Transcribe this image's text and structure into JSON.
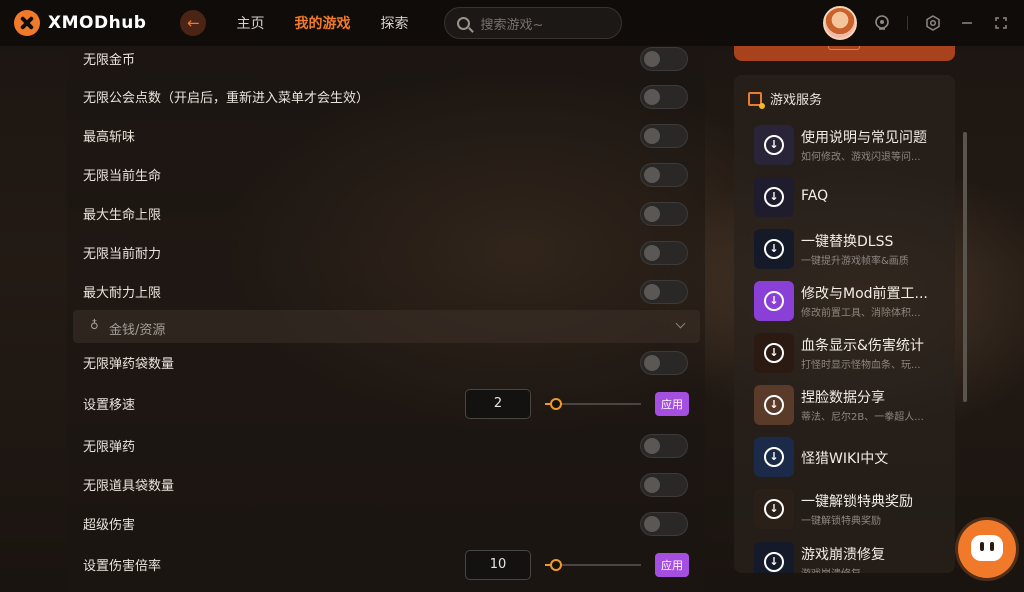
{
  "app": {
    "name": "XMODhub",
    "brand_color": "#f07a2a"
  },
  "nav": {
    "items": [
      {
        "label": "主页",
        "active": false
      },
      {
        "label": "我的游戏",
        "active": true
      },
      {
        "label": "探索",
        "active": false
      }
    ],
    "search_placeholder": "搜索游戏~"
  },
  "toolbar": {
    "icons": [
      "avatar",
      "notification-icon",
      "settings-icon",
      "minimize-icon",
      "maximize-icon"
    ]
  },
  "settings": {
    "rows_top": [
      {
        "label": "无限金币",
        "enabled": false
      },
      {
        "label": "无限公会点数（开启后，重新进入菜单才会生效）",
        "enabled": false
      },
      {
        "label": "最高斩味",
        "enabled": false
      },
      {
        "label": "无限当前生命",
        "enabled": false
      },
      {
        "label": "最大生命上限",
        "enabled": false
      },
      {
        "label": "无限当前耐力",
        "enabled": false
      },
      {
        "label": "最大耐力上限",
        "enabled": false
      }
    ],
    "section": {
      "label": "金钱/资源",
      "icon": "money-bag-icon"
    },
    "rows_bottom": [
      {
        "label": "无限弹药袋数量",
        "type": "toggle",
        "enabled": false
      },
      {
        "label": "设置移速",
        "type": "slider",
        "value": "2",
        "apply": "应用",
        "level": 0.05
      },
      {
        "label": "无限弹药",
        "type": "toggle",
        "enabled": false
      },
      {
        "label": "无限道具袋数量",
        "type": "toggle",
        "enabled": false
      },
      {
        "label": "超级伤害",
        "type": "toggle",
        "enabled": false
      },
      {
        "label": "设置伤害倍率",
        "type": "slider",
        "value": "10",
        "apply": "应用",
        "level": 0.05
      }
    ]
  },
  "services": {
    "title": "游戏服务",
    "items": [
      {
        "title": "使用说明与常见问题",
        "subtitle": "如何修改、游戏闪退等问...",
        "thumb": "#2a2438"
      },
      {
        "title": "FAQ",
        "subtitle": "",
        "thumb": "#1f1c2e"
      },
      {
        "title": "一键替换DLSS",
        "subtitle": "一键提升游戏帧率&画质",
        "thumb": "#151a28"
      },
      {
        "title": "修改与Mod前置工...",
        "subtitle": "修改前置工具、消除体积...",
        "thumb": "#8a3fd6"
      },
      {
        "title": "血条显示&伤害统计",
        "subtitle": "打怪时显示怪物血条、玩...",
        "thumb": "#2a1a12"
      },
      {
        "title": "捏脸数据分享",
        "subtitle": "蒂法、尼尔2B、一拳超人...",
        "thumb": "#5a3a28"
      },
      {
        "title": "怪猎WIKI中文",
        "subtitle": "",
        "thumb": "#1a2a48"
      },
      {
        "title": "一键解锁特典奖励",
        "subtitle": "一键解锁特典奖励",
        "thumb": "#2a2018"
      },
      {
        "title": "游戏崩溃修复",
        "subtitle": "游戏崩溃修复",
        "thumb": "#141a2a"
      }
    ]
  }
}
